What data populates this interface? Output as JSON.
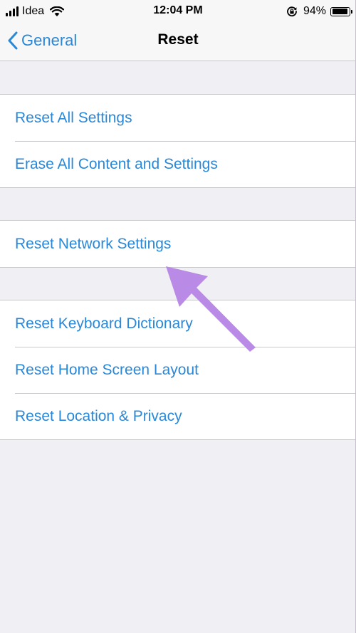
{
  "status_bar": {
    "carrier": "Idea",
    "time": "12:04 PM",
    "battery_percent": "94%",
    "battery_level": 0.94,
    "icons": [
      "signal-icon",
      "wifi-icon",
      "rotation-lock-icon",
      "battery-icon"
    ]
  },
  "nav": {
    "back_label": "General",
    "title": "Reset"
  },
  "groups": [
    {
      "items": [
        "Reset All Settings",
        "Erase All Content and Settings"
      ]
    },
    {
      "items": [
        "Reset Network Settings"
      ]
    },
    {
      "items": [
        "Reset Keyboard Dictionary",
        "Reset Home Screen Layout",
        "Reset Location & Privacy"
      ]
    }
  ],
  "colors": {
    "accent": "#2a88d8",
    "background": "#efeff4",
    "arrow": "#b98ae6"
  }
}
